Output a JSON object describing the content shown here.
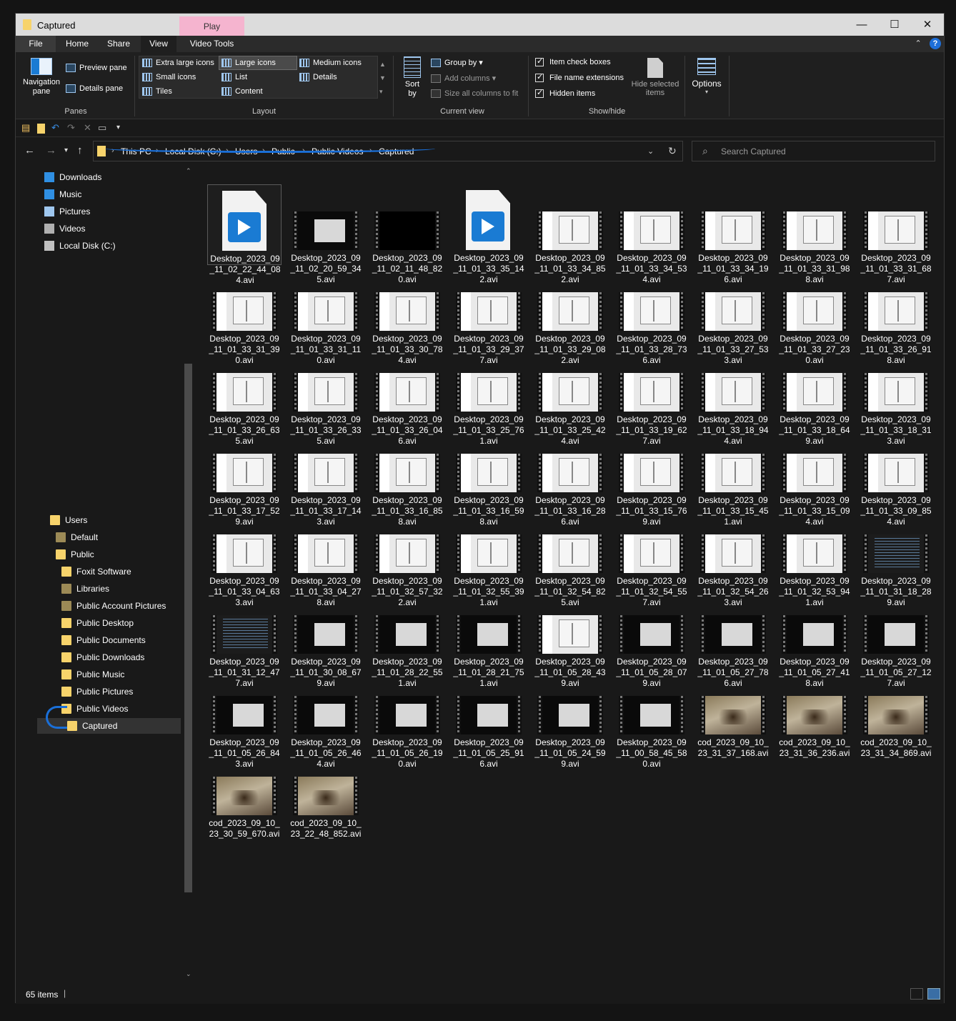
{
  "window": {
    "title": "Captured",
    "context_tab": "Play",
    "controls": {
      "minimize": "—",
      "maximize": "☐",
      "close": "✕"
    }
  },
  "ribbon_tabs": [
    "File",
    "Home",
    "Share",
    "View",
    "Video Tools"
  ],
  "ribbon": {
    "panes": {
      "navigation_pane": "Navigation\npane",
      "preview_pane": "Preview pane",
      "details_pane": "Details pane",
      "label": "Panes"
    },
    "layout": {
      "extra_large_icons": "Extra large icons",
      "large_icons": "Large icons",
      "medium_icons": "Medium icons",
      "small_icons": "Small icons",
      "list": "List",
      "details": "Details",
      "tiles": "Tiles",
      "content": "Content",
      "label": "Layout"
    },
    "current_view": {
      "sort_by": "Sort\nby",
      "group_by": "Group by",
      "add_columns": "Add columns",
      "size_columns": "Size all columns to fit",
      "label": "Current view"
    },
    "show_hide": {
      "item_check_boxes": "Item check boxes",
      "file_name_extensions": "File name extensions",
      "hidden_items": "Hidden items",
      "hide_selected": "Hide selected\nitems",
      "label": "Show/hide"
    },
    "options": "Options"
  },
  "address": {
    "crumbs": [
      "This PC",
      "Local Disk (C:)",
      "Users",
      "Public",
      "Public Videos",
      "Captured"
    ],
    "search_placeholder": "Search Captured"
  },
  "nav": {
    "top_items": [
      {
        "label": "Downloads",
        "icon": "download-icon"
      },
      {
        "label": "Music",
        "icon": "music-icon"
      },
      {
        "label": "Pictures",
        "icon": "pictures-icon"
      },
      {
        "label": "Videos",
        "icon": "videos-icon"
      },
      {
        "label": "Local Disk (C:)",
        "icon": "drive-icon"
      }
    ],
    "tree": [
      {
        "label": "Users",
        "level": 0
      },
      {
        "label": "Default",
        "level": 1
      },
      {
        "label": "Public",
        "level": 1
      },
      {
        "label": "Foxit Software",
        "level": 2
      },
      {
        "label": "Libraries",
        "level": 2
      },
      {
        "label": "Public Account Pictures",
        "level": 2
      },
      {
        "label": "Public Desktop",
        "level": 2
      },
      {
        "label": "Public Documents",
        "level": 2
      },
      {
        "label": "Public Downloads",
        "level": 2
      },
      {
        "label": "Public Music",
        "level": 2
      },
      {
        "label": "Public Pictures",
        "level": 2
      },
      {
        "label": "Public Videos",
        "level": 2
      },
      {
        "label": "Captured",
        "level": 3,
        "selected": true
      }
    ]
  },
  "files": [
    {
      "name": "Desktop_2023_09_11_02_22_44_084.avi",
      "thumb": "icon"
    },
    {
      "name": "Desktop_2023_09_11_02_20_59_345.avi",
      "thumb": "dark"
    },
    {
      "name": "Desktop_2023_09_11_02_11_48_820.avi",
      "thumb": "black"
    },
    {
      "name": "Desktop_2023_09_11_01_33_35_142.avi",
      "thumb": "icon"
    },
    {
      "name": "Desktop_2023_09_11_01_33_34_852.avi",
      "thumb": "win"
    },
    {
      "name": "Desktop_2023_09_11_01_33_34_534.avi",
      "thumb": "win"
    },
    {
      "name": "Desktop_2023_09_11_01_33_34_196.avi",
      "thumb": "win"
    },
    {
      "name": "Desktop_2023_09_11_01_33_31_988.avi",
      "thumb": "win"
    },
    {
      "name": "Desktop_2023_09_11_01_33_31_687.avi",
      "thumb": "win"
    },
    {
      "name": "Desktop_2023_09_11_01_33_31_390.avi",
      "thumb": "win"
    },
    {
      "name": "Desktop_2023_09_11_01_33_31_110.avi",
      "thumb": "win"
    },
    {
      "name": "Desktop_2023_09_11_01_33_30_784.avi",
      "thumb": "win"
    },
    {
      "name": "Desktop_2023_09_11_01_33_29_377.avi",
      "thumb": "win"
    },
    {
      "name": "Desktop_2023_09_11_01_33_29_082.avi",
      "thumb": "win"
    },
    {
      "name": "Desktop_2023_09_11_01_33_28_736.avi",
      "thumb": "win"
    },
    {
      "name": "Desktop_2023_09_11_01_33_27_533.avi",
      "thumb": "win"
    },
    {
      "name": "Desktop_2023_09_11_01_33_27_230.avi",
      "thumb": "win"
    },
    {
      "name": "Desktop_2023_09_11_01_33_26_918.avi",
      "thumb": "win"
    },
    {
      "name": "Desktop_2023_09_11_01_33_26_635.avi",
      "thumb": "win"
    },
    {
      "name": "Desktop_2023_09_11_01_33_26_335.avi",
      "thumb": "win"
    },
    {
      "name": "Desktop_2023_09_11_01_33_26_046.avi",
      "thumb": "win"
    },
    {
      "name": "Desktop_2023_09_11_01_33_25_761.avi",
      "thumb": "win"
    },
    {
      "name": "Desktop_2023_09_11_01_33_25_424.avi",
      "thumb": "win"
    },
    {
      "name": "Desktop_2023_09_11_01_33_19_627.avi",
      "thumb": "win"
    },
    {
      "name": "Desktop_2023_09_11_01_33_18_944.avi",
      "thumb": "win"
    },
    {
      "name": "Desktop_2023_09_11_01_33_18_649.avi",
      "thumb": "win"
    },
    {
      "name": "Desktop_2023_09_11_01_33_18_313.avi",
      "thumb": "win"
    },
    {
      "name": "Desktop_2023_09_11_01_33_17_529.avi",
      "thumb": "win"
    },
    {
      "name": "Desktop_2023_09_11_01_33_17_143.avi",
      "thumb": "win"
    },
    {
      "name": "Desktop_2023_09_11_01_33_16_858.avi",
      "thumb": "win"
    },
    {
      "name": "Desktop_2023_09_11_01_33_16_598.avi",
      "thumb": "win"
    },
    {
      "name": "Desktop_2023_09_11_01_33_16_286.avi",
      "thumb": "win"
    },
    {
      "name": "Desktop_2023_09_11_01_33_15_769.avi",
      "thumb": "win"
    },
    {
      "name": "Desktop_2023_09_11_01_33_15_451.avi",
      "thumb": "win"
    },
    {
      "name": "Desktop_2023_09_11_01_33_15_094.avi",
      "thumb": "win"
    },
    {
      "name": "Desktop_2023_09_11_01_33_09_854.avi",
      "thumb": "win"
    },
    {
      "name": "Desktop_2023_09_11_01_33_04_633.avi",
      "thumb": "win"
    },
    {
      "name": "Desktop_2023_09_11_01_33_04_278.avi",
      "thumb": "win"
    },
    {
      "name": "Desktop_2023_09_11_01_32_57_322.avi",
      "thumb": "win"
    },
    {
      "name": "Desktop_2023_09_11_01_32_55_391.avi",
      "thumb": "win"
    },
    {
      "name": "Desktop_2023_09_11_01_32_54_825.avi",
      "thumb": "win"
    },
    {
      "name": "Desktop_2023_09_11_01_32_54_557.avi",
      "thumb": "win"
    },
    {
      "name": "Desktop_2023_09_11_01_32_54_263.avi",
      "thumb": "win"
    },
    {
      "name": "Desktop_2023_09_11_01_32_53_941.avi",
      "thumb": "win"
    },
    {
      "name": "Desktop_2023_09_11_01_31_18_289.avi",
      "thumb": "term"
    },
    {
      "name": "Desktop_2023_09_11_01_31_12_477.avi",
      "thumb": "term"
    },
    {
      "name": "Desktop_2023_09_11_01_30_08_679.avi",
      "thumb": "dark"
    },
    {
      "name": "Desktop_2023_09_11_01_28_22_551.avi",
      "thumb": "dark"
    },
    {
      "name": "Desktop_2023_09_11_01_28_21_751.avi",
      "thumb": "dark"
    },
    {
      "name": "Desktop_2023_09_11_01_05_28_439.avi",
      "thumb": "win"
    },
    {
      "name": "Desktop_2023_09_11_01_05_28_079.avi",
      "thumb": "dark"
    },
    {
      "name": "Desktop_2023_09_11_01_05_27_786.avi",
      "thumb": "dark"
    },
    {
      "name": "Desktop_2023_09_11_01_05_27_418.avi",
      "thumb": "dark"
    },
    {
      "name": "Desktop_2023_09_11_01_05_27_127.avi",
      "thumb": "dark"
    },
    {
      "name": "Desktop_2023_09_11_01_05_26_843.avi",
      "thumb": "dark"
    },
    {
      "name": "Desktop_2023_09_11_01_05_26_464.avi",
      "thumb": "dark"
    },
    {
      "name": "Desktop_2023_09_11_01_05_26_190.avi",
      "thumb": "dark"
    },
    {
      "name": "Desktop_2023_09_11_01_05_25_916.avi",
      "thumb": "dark"
    },
    {
      "name": "Desktop_2023_09_11_01_05_24_599.avi",
      "thumb": "dark"
    },
    {
      "name": "Desktop_2023_09_11_00_58_45_580.avi",
      "thumb": "dark"
    },
    {
      "name": "cod_2023_09_10_23_31_37_168.avi",
      "thumb": "game"
    },
    {
      "name": "cod_2023_09_10_23_31_36_236.avi",
      "thumb": "game"
    },
    {
      "name": "cod_2023_09_10_23_31_34_869.avi",
      "thumb": "game"
    },
    {
      "name": "cod_2023_09_10_23_30_59_670.avi",
      "thumb": "game"
    },
    {
      "name": "cod_2023_09_10_23_22_48_852.avi",
      "thumb": "game"
    }
  ],
  "status": {
    "count": "65 items"
  }
}
